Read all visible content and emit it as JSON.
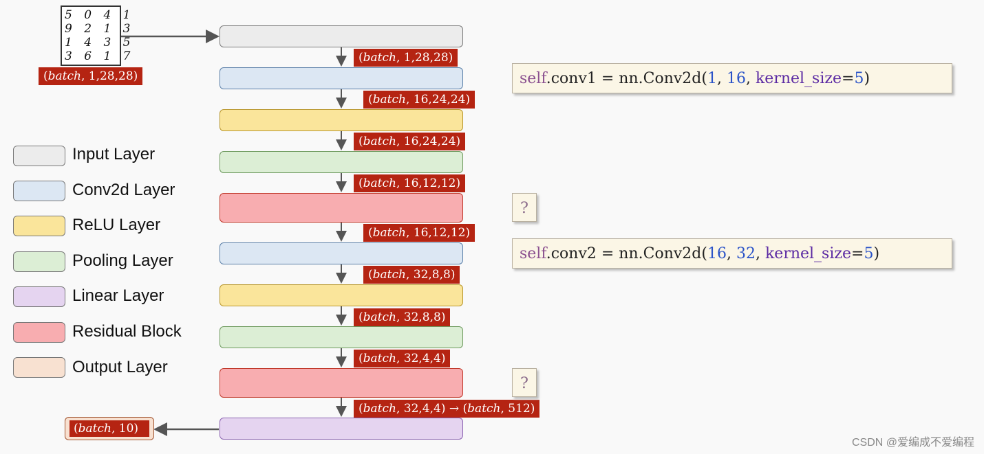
{
  "mnist": {
    "rows": [
      "5 0 4 1",
      "9 2 1 3",
      "1 4 3 5",
      "3 6 1 7"
    ],
    "shape": [
      "(",
      "batch",
      ", 1,28,28)"
    ]
  },
  "shapes": [
    [
      "(",
      "batch",
      ", 1,28,28)"
    ],
    [
      "(",
      "batch",
      ", 16,24,24)"
    ],
    [
      "(",
      "batch",
      ", 16,24,24)"
    ],
    [
      "(",
      "batch",
      ", 16,12,12)"
    ],
    [
      "(",
      "batch",
      ", 16,12,12)"
    ],
    [
      "(",
      "batch",
      ", 32,8,8)"
    ],
    [
      "(",
      "batch",
      ", 32,8,8)"
    ],
    [
      "(",
      "batch",
      ", 32,4,4)"
    ],
    [
      "(",
      "batch",
      ", 32,4,4) → (",
      "batch",
      ", 512)"
    ]
  ],
  "output_shape": [
    "(",
    "batch",
    ", 10)"
  ],
  "legend": [
    {
      "label": "Input Layer",
      "type": "input"
    },
    {
      "label": "Conv2d Layer",
      "type": "conv"
    },
    {
      "label": "ReLU Layer",
      "type": "relu"
    },
    {
      "label": "Pooling Layer",
      "type": "pool"
    },
    {
      "label": "Linear Layer",
      "type": "linear"
    },
    {
      "label": "Residual Block",
      "type": "resid"
    },
    {
      "label": "Output Layer",
      "type": "output"
    }
  ],
  "code": {
    "conv1": {
      "self": "self",
      "mid": ".conv1 = nn.Conv2d(",
      "a": "1",
      "sep1": ",  ",
      "b": "16",
      "sep2": ",  ",
      "kw": "kernel_size",
      "eq": "=",
      "k": "5",
      "end": ")"
    },
    "conv2": {
      "self": "self",
      "mid": ".conv2 = nn.Conv2d(",
      "a": "16",
      "sep1": ",  ",
      "b": "32",
      "sep2": ",  ",
      "kw": "kernel_size",
      "eq": "=",
      "k": "5",
      "end": ")"
    },
    "residual_1": "?",
    "residual_2": "?"
  },
  "watermark": "CSDN @爱编成不爱编程",
  "colors": {
    "input": "#ececec",
    "conv": "#dce7f3",
    "relu": "#fae59b",
    "pool": "#dceed5",
    "linear": "#e5d4f0",
    "resid": "#f8adb0",
    "output": "#f8e1d1",
    "shape_label": "#b52412"
  }
}
